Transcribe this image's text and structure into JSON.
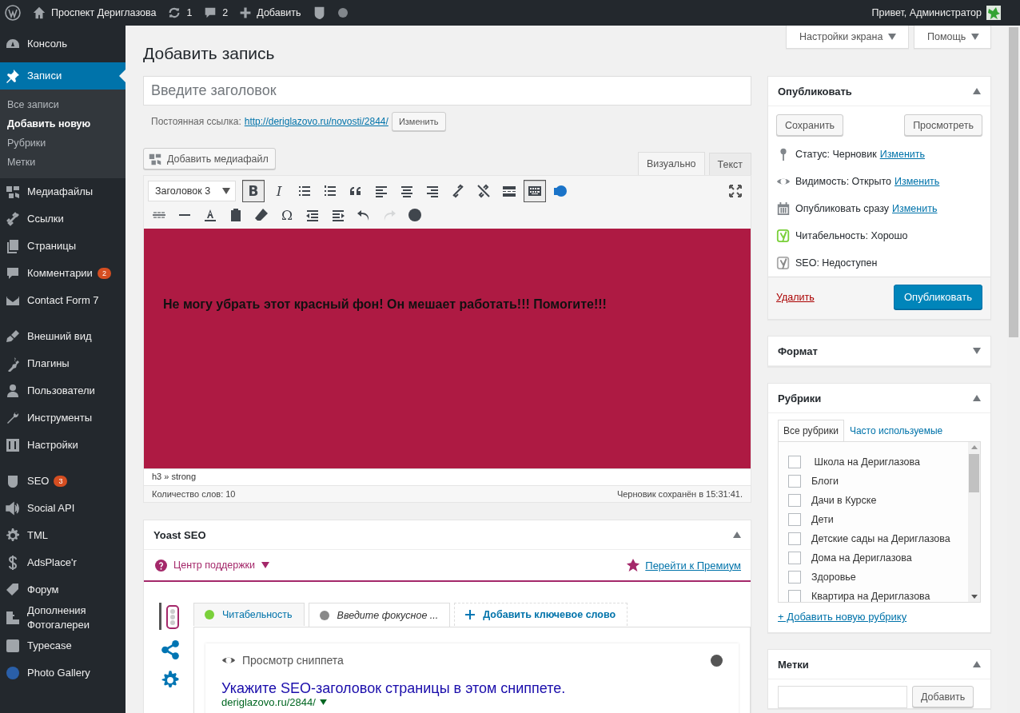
{
  "admin_bar": {
    "site": "Проспект Дериглазова",
    "updates": "1",
    "comments": "2",
    "new": "Добавить",
    "greeting": "Привет, Администратор"
  },
  "screen_tabs": [
    "Настройки экрана",
    "Помощь"
  ],
  "sidebar": {
    "groups": [
      [
        {
          "label": "Консоль",
          "selected": false
        },
        {
          "label": "Записи",
          "selected": true,
          "children": [
            {
              "label": "Все записи",
              "selected": false
            },
            {
              "label": "Добавить новую",
              "selected": true
            },
            {
              "label": "Рубрики",
              "selected": false
            },
            {
              "label": "Метки",
              "selected": false
            }
          ]
        },
        {
          "label": "Медиафайлы",
          "selected": false
        },
        {
          "label": "Ссылки",
          "selected": false
        },
        {
          "label": "Страницы",
          "selected": false
        },
        {
          "label": "Комментарии",
          "selected": false,
          "badge": "2"
        },
        {
          "label": "Contact Form 7",
          "selected": false
        }
      ],
      [
        {
          "label": "Внешний вид",
          "selected": false
        },
        {
          "label": "Плагины",
          "selected": false
        },
        {
          "label": "Пользователи",
          "selected": false
        },
        {
          "label": "Инструменты",
          "selected": false
        },
        {
          "label": "Настройки",
          "selected": false
        }
      ],
      [
        {
          "label": "SEO",
          "selected": false,
          "badge": "3"
        },
        {
          "label": "Social API",
          "selected": false
        },
        {
          "label": "TML",
          "selected": false
        },
        {
          "label": "AdsPlace'r",
          "selected": false
        },
        {
          "label": "Форум",
          "selected": false
        },
        {
          "label": "Дополнения Фотогалереи",
          "selected": false
        },
        {
          "label": "Typecase",
          "selected": false
        },
        {
          "label": "Photo Gallery",
          "selected": false
        }
      ]
    ]
  },
  "page_title": "Добавить запись",
  "title_field": {
    "placeholder": "Введите заголовок"
  },
  "permalink": {
    "label": "Постоянная ссылка:",
    "url": "http://deriglazovo.ru/novosti/2844/",
    "button": "Изменить"
  },
  "editor": {
    "add_media": "Добавить медиафайл",
    "tabs": [
      {
        "label": "Визуально",
        "selected": true
      },
      {
        "label": "Текст",
        "selected": false
      }
    ],
    "format": "Заголовок 3",
    "toolbar": [
      [
        {
          "glyph": "B",
          "pressed": true,
          "disabled": false
        },
        {
          "glyph": "I",
          "pressed": false,
          "disabled": false
        },
        {
          "pressed": false,
          "disabled": false
        },
        {
          "pressed": false,
          "disabled": false
        },
        {
          "pressed": false,
          "disabled": false
        },
        {
          "pressed": false,
          "disabled": false
        },
        {
          "pressed": false,
          "disabled": false
        },
        {
          "pressed": false,
          "disabled": false
        },
        {
          "pressed": false,
          "disabled": false
        },
        {
          "pressed": false,
          "disabled": false
        },
        {
          "pressed": false,
          "disabled": false
        },
        {
          "pressed": true,
          "disabled": false
        },
        {
          "pressed": false,
          "disabled": false
        }
      ],
      [
        {
          "pressed": false,
          "disabled": false
        },
        {
          "pressed": false,
          "disabled": false
        },
        {
          "pressed": false,
          "disabled": false
        },
        {
          "pressed": false,
          "disabled": false
        },
        {
          "pressed": false,
          "disabled": false
        },
        {
          "glyph": "Ω",
          "pressed": false,
          "disabled": false
        },
        {
          "pressed": false,
          "disabled": false
        },
        {
          "pressed": false,
          "disabled": false
        },
        {
          "pressed": false,
          "disabled": false
        },
        {
          "pressed": false,
          "disabled": true
        },
        {
          "pressed": false,
          "disabled": false
        }
      ]
    ],
    "content": "Не могу убрать этот красный фон! Он мешает работать!!! Помогите!!!",
    "path": "h3 » strong",
    "word_count": "Количество слов: 10",
    "saved": "Черновик сохранён в 15:31:41."
  },
  "yoast": {
    "title": "Yoast SEO",
    "expanded": true,
    "help": "Центр поддержки",
    "premium": "Перейти к Премиум",
    "tabs": [
      {
        "label": "Читабельность",
        "color": "#7ad03a",
        "selected": false
      },
      {
        "label": "Введите фокусное ...",
        "color": "#888888",
        "selected": true
      }
    ],
    "add_keyword": "Добавить ключевое слово",
    "snippet": {
      "heading": "Просмотр сниппета",
      "title": "Укажите SEO-заголовок страницы в этом сниппете.",
      "url": "deriglazovo.ru/2844/"
    }
  },
  "publish": {
    "title": "Опубликовать",
    "expanded": true,
    "save": "Сохранить",
    "preview": "Просмотреть",
    "rows": [
      {
        "label": "Статус: Черновик",
        "link": "Изменить"
      },
      {
        "label": "Видимость: Открыто",
        "link": "Изменить"
      },
      {
        "label": "Опубликовать сразу",
        "link": "Изменить"
      },
      {
        "label": "Читабельность: Хорошо"
      },
      {
        "label": "SEO: Недоступен"
      }
    ],
    "delete": "Удалить",
    "publish": "Опубликовать"
  },
  "format_box": {
    "title": "Формат",
    "expanded": false
  },
  "categories": {
    "title": "Рубрики",
    "expanded": true,
    "tabs": [
      {
        "label": "Все рубрики",
        "selected": true
      },
      {
        "label": "Часто используемые",
        "selected": false
      }
    ],
    "items": [
      {
        "label": " Школа на Дериглазова",
        "checked": false
      },
      {
        "label": "Блоги",
        "checked": false
      },
      {
        "label": "Дачи в Курске",
        "checked": false
      },
      {
        "label": "Дети",
        "checked": false
      },
      {
        "label": "Детские сады на Дериглазова",
        "checked": false
      },
      {
        "label": "Дома на Дериглазова",
        "checked": false
      },
      {
        "label": "Здоровье",
        "checked": false
      },
      {
        "label": "Квартира на Дериглазова",
        "checked": false
      }
    ],
    "add": "+ Добавить новую рубрику"
  },
  "tags": {
    "title": "Метки",
    "expanded": true,
    "button": "Добавить"
  }
}
